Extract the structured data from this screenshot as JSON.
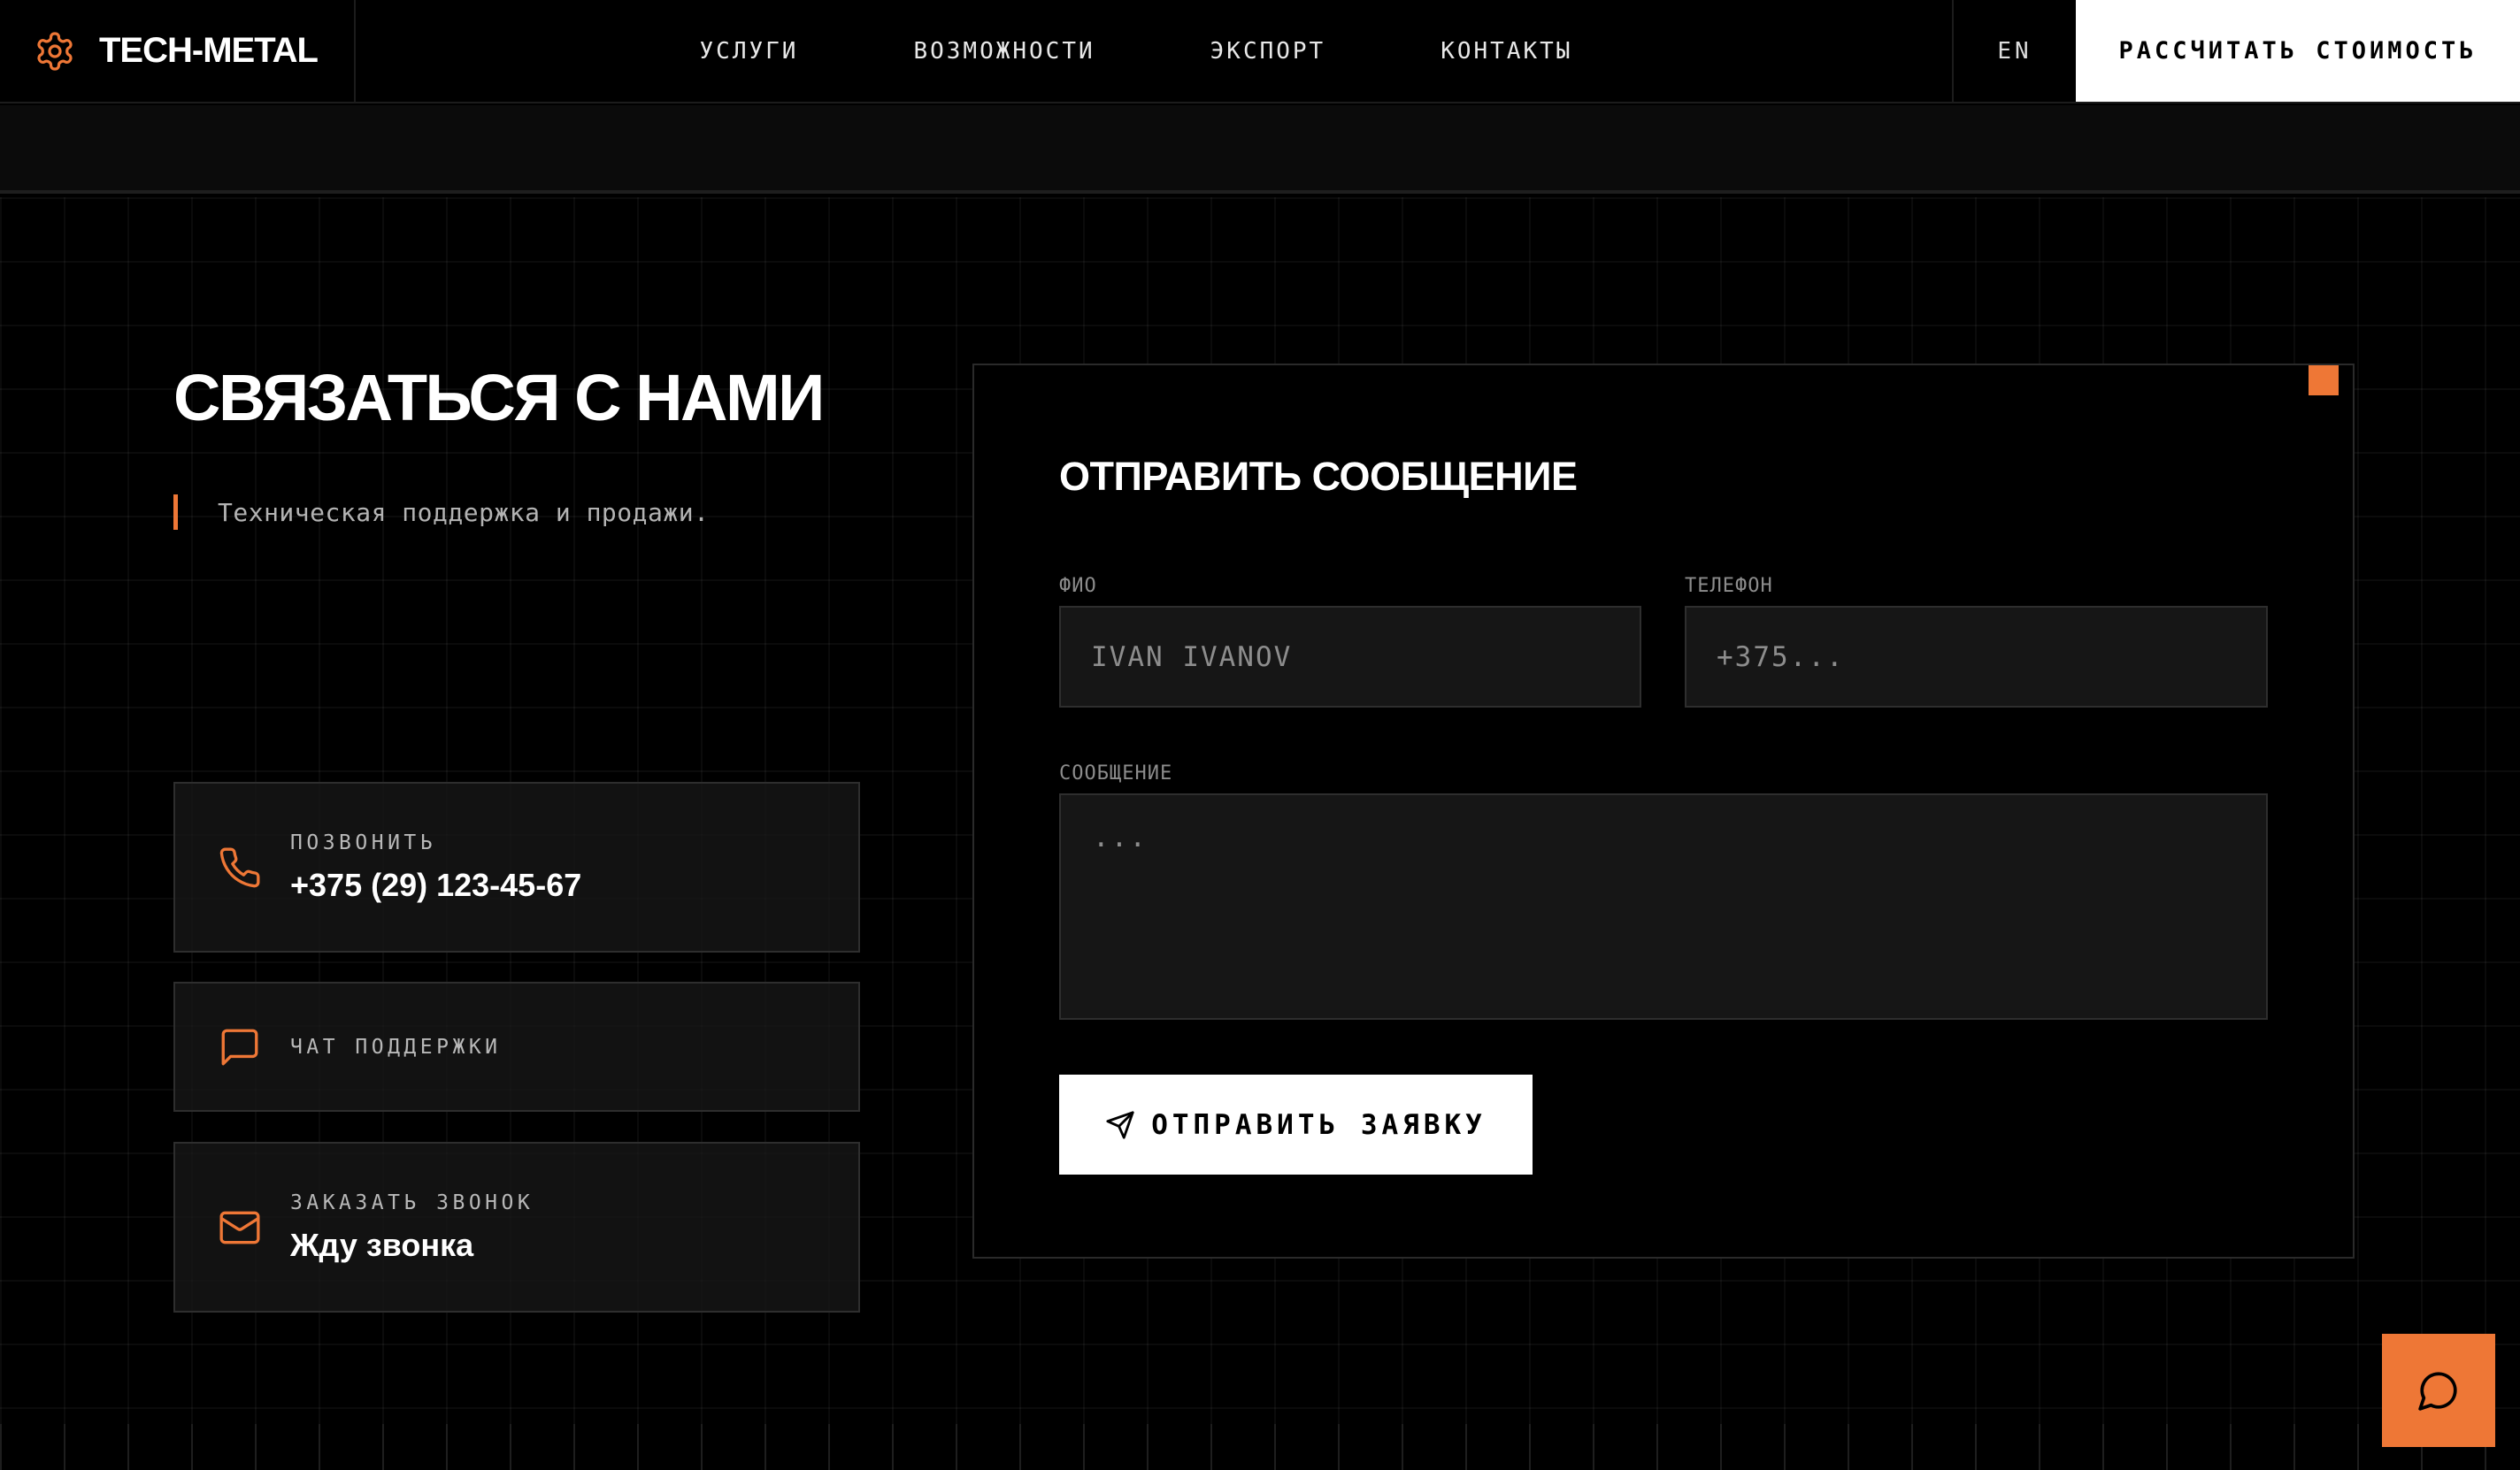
{
  "header": {
    "brand_name": "TECH-METAL",
    "nav": [
      "УСЛУГИ",
      "ВОЗМОЖНОСТИ",
      "ЭКСПОРТ",
      "КОНТАКТЫ"
    ],
    "lang": "EN",
    "cta": "РАССЧИТАТЬ СТОИМОСТЬ"
  },
  "contact": {
    "title": "СВЯЗАТЬСЯ С НАМИ",
    "subtitle": "Техническая поддержка и продажи.",
    "cards": [
      {
        "label": "ПОЗВОНИТЬ",
        "value": "+375 (29) 123-45-67",
        "icon": "phone-icon"
      },
      {
        "label": "ЧАТ ПОДДЕРЖКИ",
        "value": "",
        "icon": "chat-icon"
      },
      {
        "label": "ЗАКАЗАТЬ ЗВОНОК",
        "value": "Жду звонка",
        "icon": "mail-icon"
      }
    ]
  },
  "form": {
    "title": "ОТПРАВИТЬ СООБЩЕНИЕ",
    "name_label": "ФИО",
    "name_placeholder": "IVAN IVANOV",
    "phone_label": "ТЕЛЕФОН",
    "phone_placeholder": "+375...",
    "message_label": "СООБЩЕНИЕ",
    "message_placeholder": "...",
    "submit": "ОТПРАВИТЬ ЗАЯВКУ"
  },
  "colors": {
    "accent": "#ee7736",
    "background": "#000000",
    "panel_border": "#2a2a2a"
  }
}
